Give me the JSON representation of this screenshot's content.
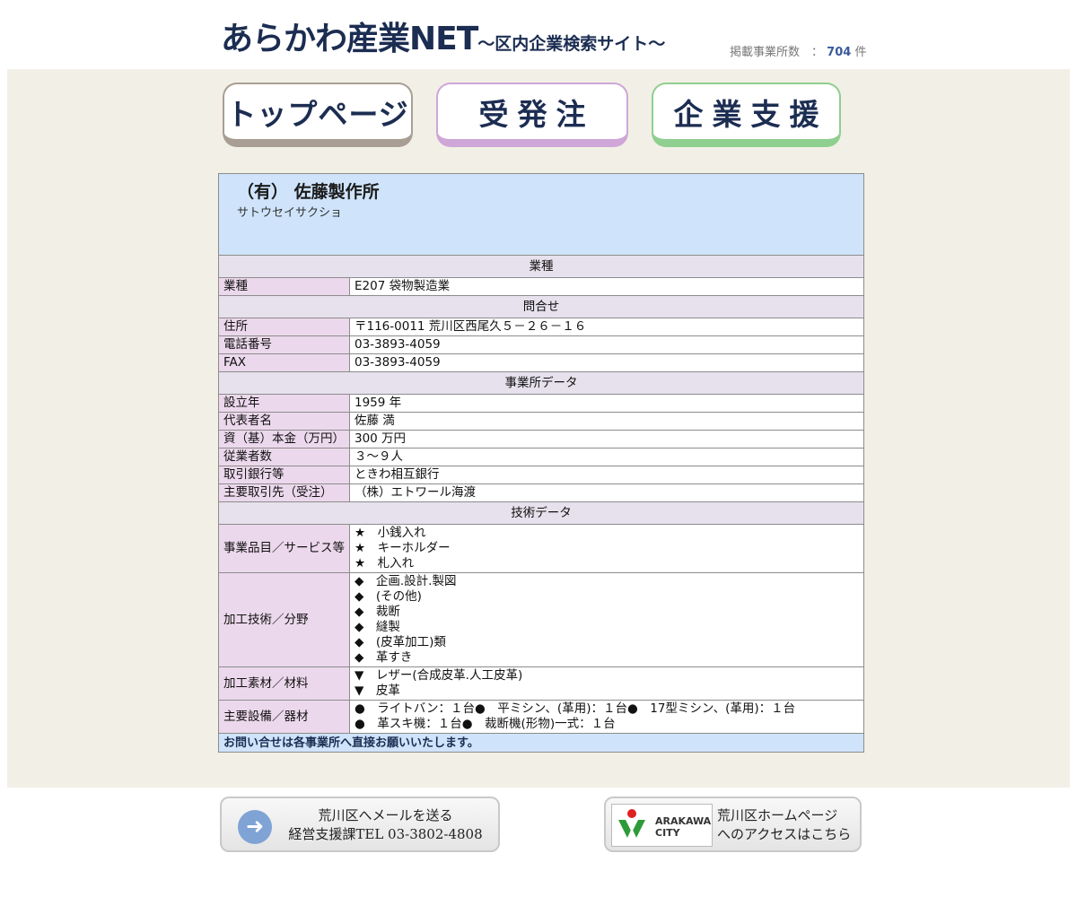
{
  "header": {
    "title": "あらかわ産業NET",
    "subtitle": "～区内企業検索サイト～",
    "count_label": "掲載事業所数　：",
    "count_value": "704",
    "count_unit": "件"
  },
  "nav": {
    "top": "トップページ",
    "order": "受発注",
    "support": "企業支援"
  },
  "company": {
    "name": "（有） 佐藤製作所",
    "kana": "サトウセイサクショ"
  },
  "sections": {
    "industry": "業種",
    "contact": "問合せ",
    "office": "事業所データ",
    "tech": "技術データ"
  },
  "rows": {
    "industry": {
      "label": "業種",
      "value": "E207 袋物製造業"
    },
    "address": {
      "label": "住所",
      "value": "〒116-0011 荒川区西尾久５－２６－１６"
    },
    "phone": {
      "label": "電話番号",
      "value": "03-3893-4059"
    },
    "fax": {
      "label": "FAX",
      "value": "03-3893-4059"
    },
    "founded": {
      "label": "設立年",
      "value": "1959 年"
    },
    "rep": {
      "label": "代表者名",
      "value": "佐藤 満"
    },
    "capital": {
      "label": "資（基）本金（万円）",
      "value": "300 万円"
    },
    "employees": {
      "label": "従業者数",
      "value": "３～９人"
    },
    "bank": {
      "label": "取引銀行等",
      "value": "ときわ相互銀行"
    },
    "client": {
      "label": "主要取引先（受注）",
      "value": "（株）エトワール海渡"
    },
    "products": {
      "label": "事業品目／サービス等",
      "items": [
        "★　小銭入れ",
        "★　キーホルダー",
        "★　札入れ"
      ]
    },
    "processing": {
      "label": "加工技術／分野",
      "items": [
        "◆　企画.設計.製図",
        "◆　(その他)",
        "◆　裁断",
        "◆　縫製",
        "◆　(皮革加工)類",
        "◆　革すき"
      ]
    },
    "materials": {
      "label": "加工素材／材料",
      "items": [
        "▼　レザー(合成皮革.人工皮革)",
        "▼　皮革"
      ]
    },
    "equipment": {
      "label": "主要設備／器材",
      "items": [
        "●　ライトバン：１台●　平ミシン、(革用)：１台●　17型ミシン、(革用)：１台",
        "●　革スキ機：１台●　裁断機(形物)一式：１台"
      ]
    }
  },
  "footer_note": "お問い合せは各事業所へ直接お願いいたします。",
  "bottom": {
    "mail_line1": "荒川区へメールを送る",
    "mail_line2": "経営支援課TEL 03-3802-4808",
    "logo_text1": "ARAKAWA",
    "logo_text2": "CITY",
    "city_line1": "荒川区ホームページ",
    "city_line2": "へのアクセスはこちら"
  }
}
